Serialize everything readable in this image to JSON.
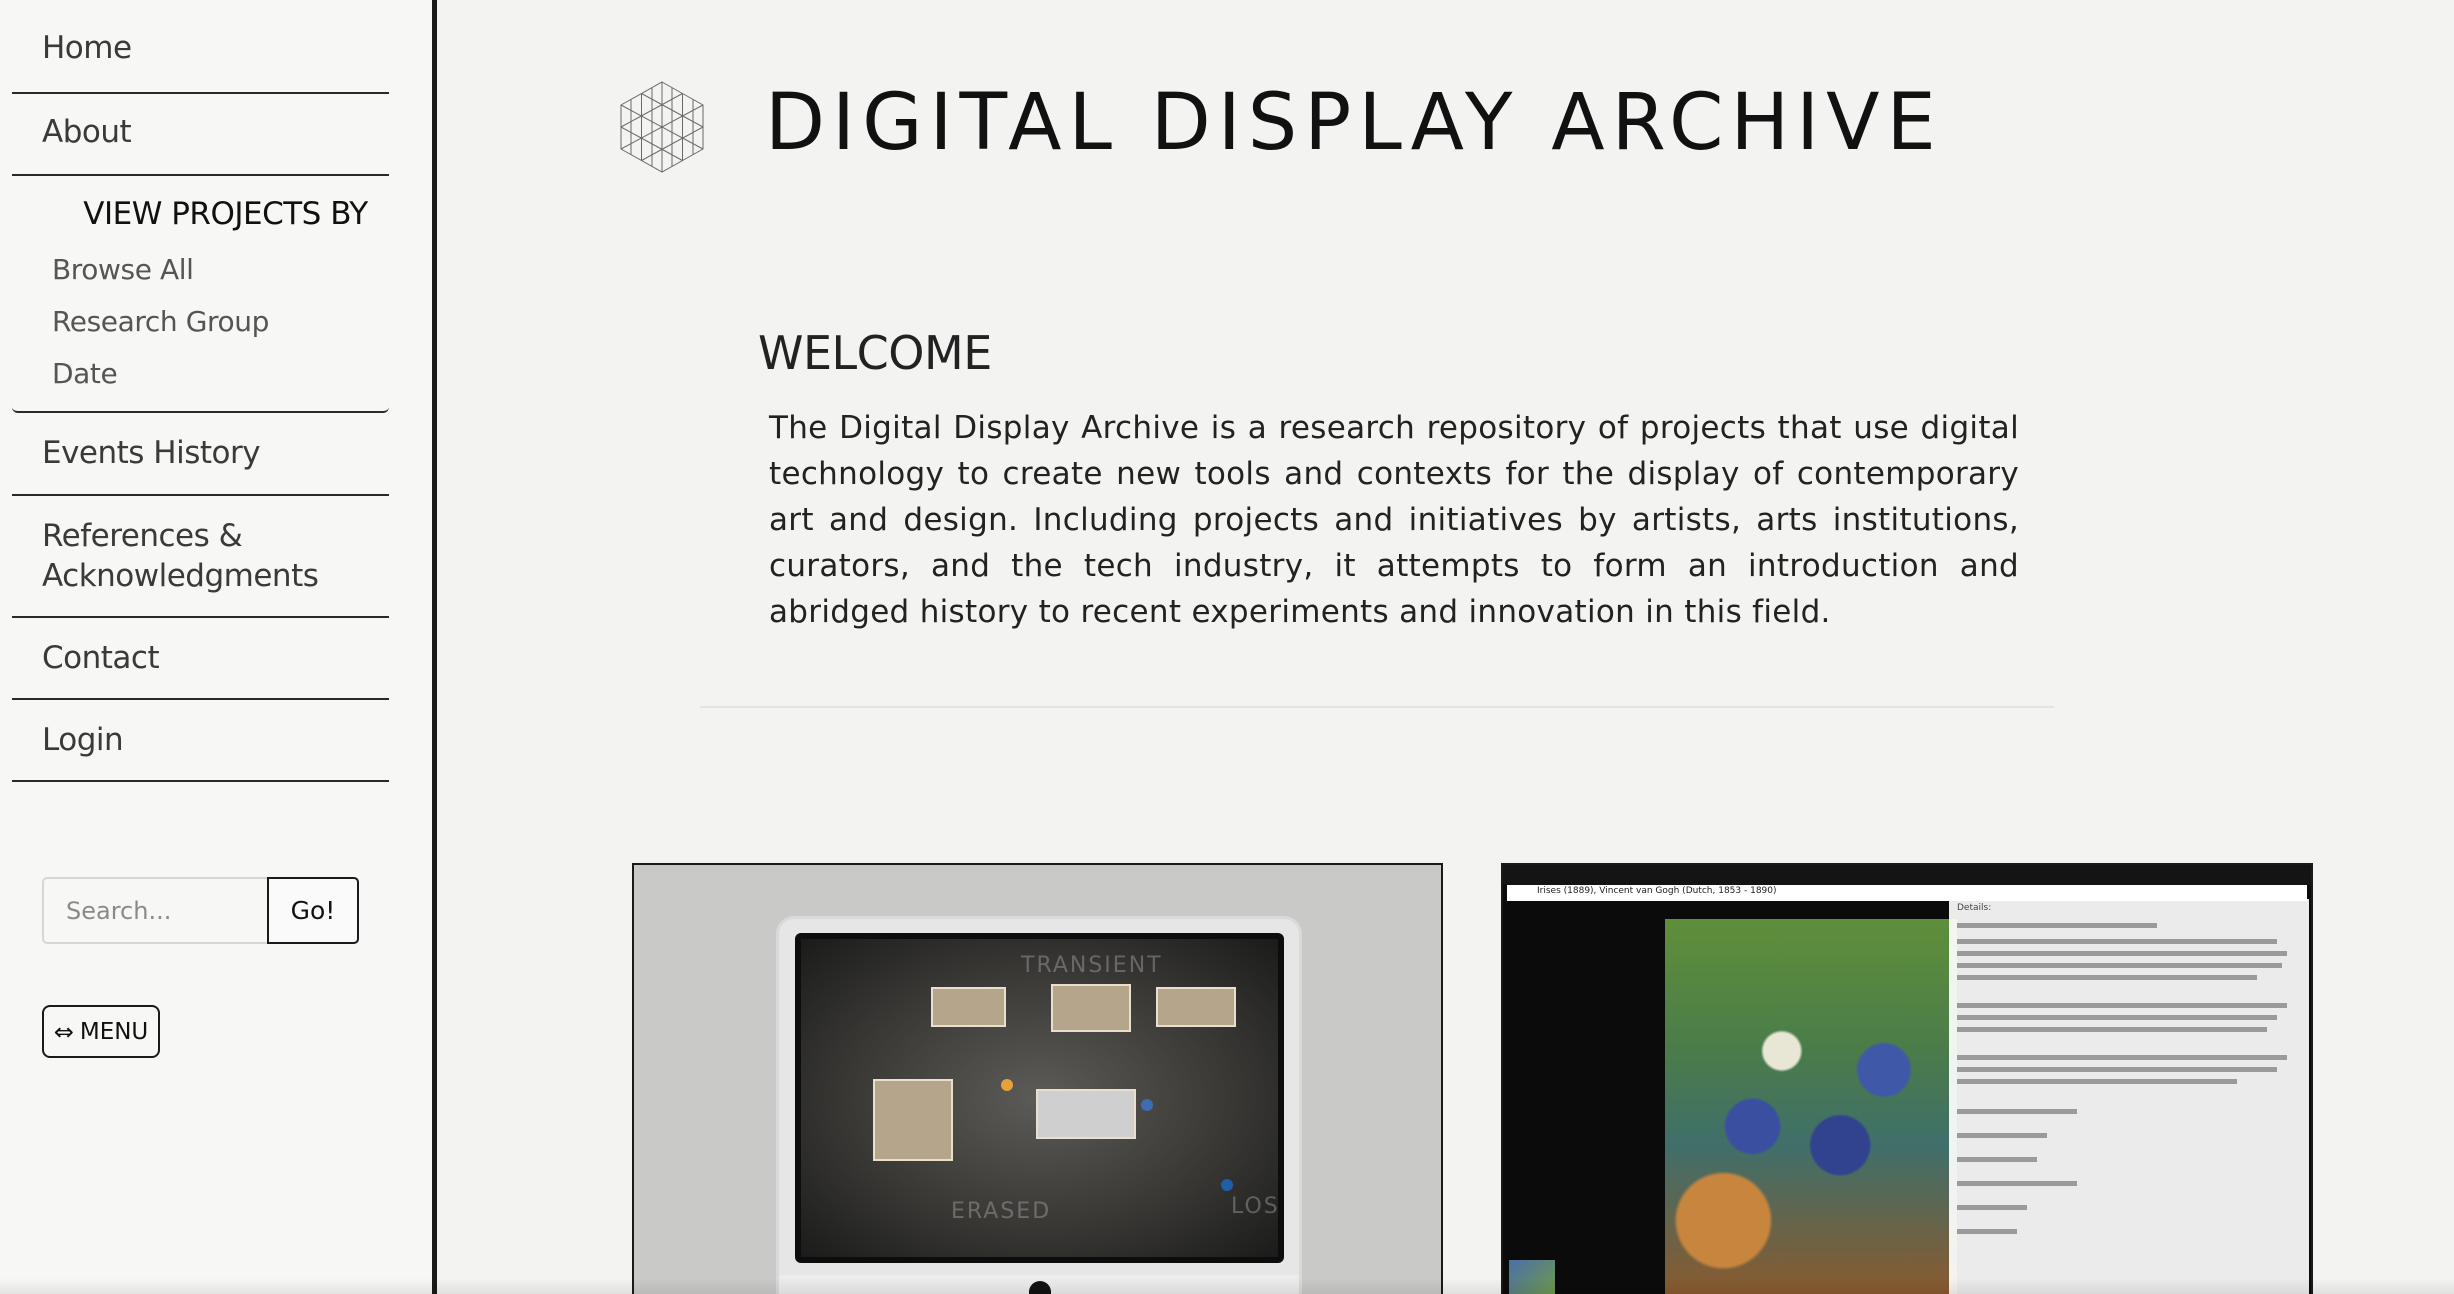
{
  "site": {
    "title": "DIGITAL DISPLAY ARCHIVE",
    "logo_icon": "hexagon-grid-logo"
  },
  "sidebar": {
    "nav": {
      "home": "Home",
      "about": "About",
      "events": "Events History",
      "references_line1": "References &",
      "references_line2": "Acknowledgments",
      "contact": "Contact",
      "login": "Login"
    },
    "projects": {
      "title": "VIEW PROJECTS BY",
      "items": [
        "Browse All",
        "Research Group",
        "Date"
      ]
    },
    "search": {
      "placeholder": "Search...",
      "button": "Go!"
    },
    "menu": {
      "icon": "⇔",
      "label": "MENU"
    }
  },
  "main": {
    "welcome_heading": "WELCOME",
    "welcome_text": "The Digital Display Archive is a research repository of projects that use digital technology to create new tools and contexts for the display of contemporary art and design. Including projects and initiatives by artists, arts institutions, curators, and the tech industry, it attempts to form an introduction and abridged history to recent experiments and innovation in this field.",
    "cards": [
      {
        "description": "iMac displaying a virtual gallery floor plan",
        "screen_labels": [
          "TRANSIENT",
          "ERASED",
          "LOS"
        ]
      },
      {
        "description": "Online collection viewer showing Irises (1889) by Vincent van Gogh",
        "viewer_title": "Irises (1889), Vincent van Gogh (Dutch, 1853 - 1890)",
        "details_label": "Details:"
      }
    ]
  },
  "colors": {
    "background": "#f3f3f1",
    "sidebar_border": "#1a1a1a",
    "text": "#2a2a2a"
  }
}
